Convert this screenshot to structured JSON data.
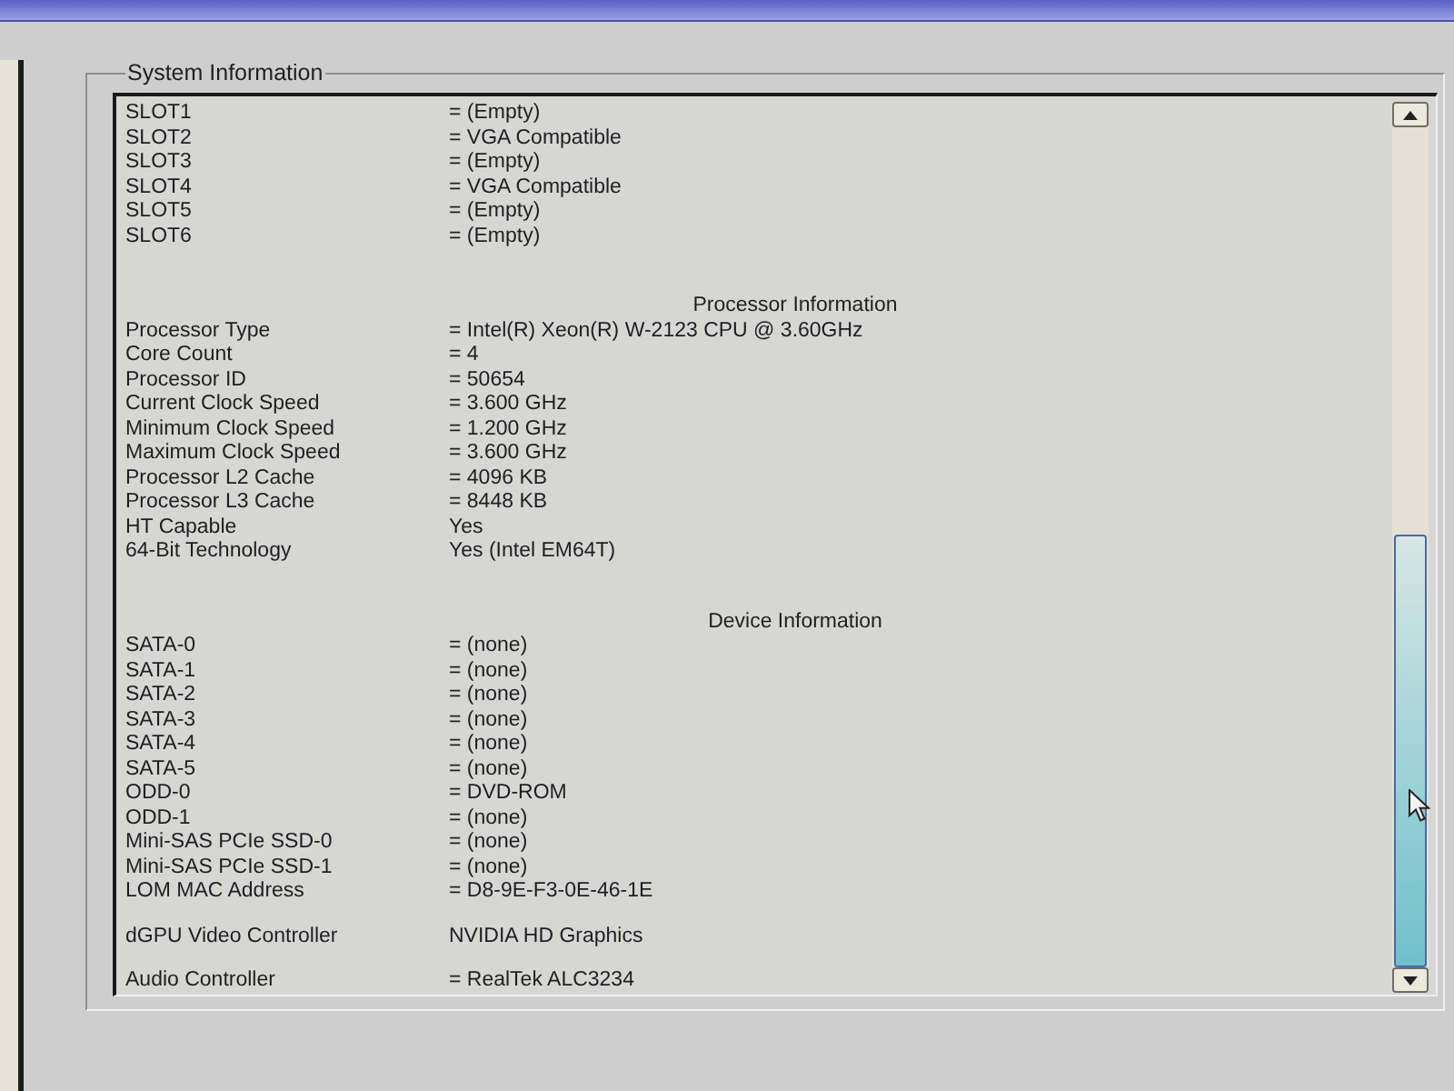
{
  "group_box": {
    "title": "System Information"
  },
  "sections": [
    {
      "rows": [
        {
          "label": "SLOT1",
          "value": "= (Empty)"
        },
        {
          "label": "SLOT2",
          "value": "= VGA Compatible"
        },
        {
          "label": "SLOT3",
          "value": "= (Empty)"
        },
        {
          "label": "SLOT4",
          "value": "= VGA Compatible"
        },
        {
          "label": "SLOT5",
          "value": "= (Empty)"
        },
        {
          "label": "SLOT6",
          "value": "= (Empty)"
        }
      ]
    },
    {
      "heading": "Processor Information",
      "rows": [
        {
          "label": "Processor Type",
          "value": "= Intel(R) Xeon(R) W-2123 CPU @ 3.60GHz"
        },
        {
          "label": "Core Count",
          "value": "= 4"
        },
        {
          "label": "Processor ID",
          "value": "= 50654"
        },
        {
          "label": "Current Clock Speed",
          "value": "= 3.600 GHz"
        },
        {
          "label": "Minimum Clock Speed",
          "value": "= 1.200 GHz"
        },
        {
          "label": "Maximum Clock Speed",
          "value": "= 3.600 GHz"
        },
        {
          "label": "Processor L2 Cache",
          "value": "= 4096 KB"
        },
        {
          "label": "Processor L3 Cache",
          "value": "= 8448 KB"
        },
        {
          "label": "HT Capable",
          "value": "Yes"
        },
        {
          "label": "64-Bit Technology",
          "value": "Yes (Intel EM64T)"
        }
      ]
    },
    {
      "heading": "Device Information",
      "rows": [
        {
          "label": "SATA-0",
          "value": "= (none)"
        },
        {
          "label": "SATA-1",
          "value": "= (none)"
        },
        {
          "label": "SATA-2",
          "value": "= (none)"
        },
        {
          "label": "SATA-3",
          "value": "= (none)"
        },
        {
          "label": "SATA-4",
          "value": "= (none)"
        },
        {
          "label": "SATA-5",
          "value": "= (none)"
        },
        {
          "label": "ODD-0",
          "value": "= DVD-ROM"
        },
        {
          "label": "ODD-1",
          "value": "= (none)"
        },
        {
          "label": "Mini-SAS PCIe SSD-0",
          "value": "= (none)"
        },
        {
          "label": "Mini-SAS PCIe SSD-1",
          "value": "= (none)"
        },
        {
          "label": "LOM MAC Address",
          "value": "= D8-9E-F3-0E-46-1E"
        }
      ]
    },
    {
      "rows": [
        {
          "label": "dGPU Video Controller",
          "value": "NVIDIA HD Graphics"
        }
      ]
    },
    {
      "rows": [
        {
          "label": "Audio Controller",
          "value": "= RealTek ALC3234"
        }
      ]
    }
  ]
}
